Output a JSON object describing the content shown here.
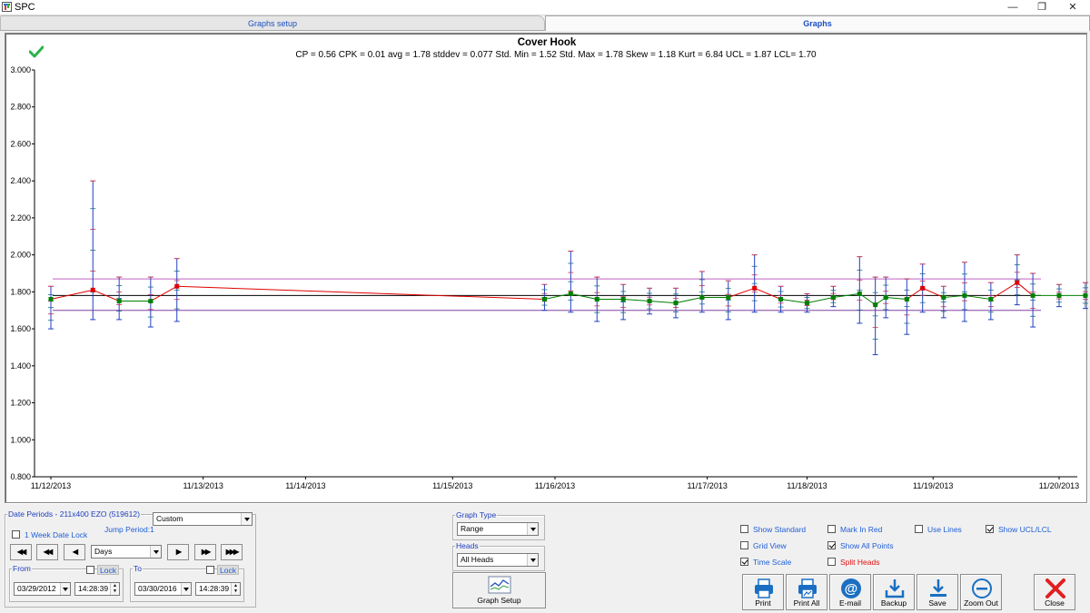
{
  "window": {
    "title": "SPC",
    "controls": [
      "—",
      "❐",
      "✕"
    ]
  },
  "tabs": [
    {
      "label": "Graphs setup",
      "active": false
    },
    {
      "label": "Graphs",
      "active": true
    }
  ],
  "chart": {
    "title": "Cover Hook",
    "stats": "CP = 0.56   CPK = 0.01   avg = 1.78   stddev = 0.077   Std. Min = 1.52   Std. Max = 1.78   Skew = 1.18   Kurt = 6.84   UCL = 1.87   LCL= 1.70",
    "status_icon": "check-icon"
  },
  "chart_data": {
    "type": "line",
    "x_axis": {
      "kind": "date",
      "range": [
        "2013-11-12",
        "2013-11-20"
      ],
      "tick_labels": [
        "11/12/2013",
        "11/13/2013",
        "11/14/2013",
        "11/15/2013",
        "11/16/2013",
        "11/17/2013",
        "11/18/2013",
        "11/19/2013",
        "11/20/2013"
      ],
      "tick_dates": [
        "2013-11-12 00:00",
        "2013-11-13 05:00",
        "2013-11-14 00:30",
        "2013-11-15 04:30",
        "2013-11-16 00:00",
        "2013-11-17 05:00",
        "2013-11-18 00:00",
        "2013-11-19 00:00",
        "2013-11-20 00:00"
      ]
    },
    "ylim": [
      0.8,
      3.0
    ],
    "y_tick_labels": [
      "0.800",
      "1.000",
      "1.200",
      "1.400",
      "1.600",
      "1.800",
      "2.000",
      "2.200",
      "2.400",
      "2.600",
      "2.800",
      "3.000"
    ],
    "control_lines": {
      "ucl": 1.87,
      "avg": 1.78,
      "lcl": 1.7
    },
    "colors": {
      "ucl": "#c060c0",
      "avg": "#000000",
      "lcl": "#8040a0",
      "series": "#008000",
      "series_alt": "#e00000",
      "range": "#2040c0",
      "range_cap": "#c03050",
      "tick": "#1a6b8a"
    },
    "points": [
      {
        "t": "2013-11-12 00:00",
        "v": 1.76,
        "min": 1.6,
        "max": 1.83
      },
      {
        "t": "2013-11-12 08:00",
        "v": 1.81,
        "min": 1.65,
        "max": 2.4
      },
      {
        "t": "2013-11-12 13:00",
        "v": 1.75,
        "min": 1.65,
        "max": 1.88
      },
      {
        "t": "2013-11-12 19:00",
        "v": 1.75,
        "min": 1.61,
        "max": 1.88
      },
      {
        "t": "2013-11-13 00:00",
        "v": 1.83,
        "min": 1.64,
        "max": 1.98
      },
      {
        "t": "2013-11-15 22:00",
        "v": 1.76,
        "min": 1.7,
        "max": 1.84
      },
      {
        "t": "2013-11-16 03:00",
        "v": 1.79,
        "min": 1.69,
        "max": 2.02
      },
      {
        "t": "2013-11-16 08:00",
        "v": 1.76,
        "min": 1.64,
        "max": 1.88
      },
      {
        "t": "2013-11-16 13:00",
        "v": 1.76,
        "min": 1.65,
        "max": 1.84
      },
      {
        "t": "2013-11-16 18:00",
        "v": 1.75,
        "min": 1.68,
        "max": 1.82
      },
      {
        "t": "2013-11-16 23:00",
        "v": 1.74,
        "min": 1.66,
        "max": 1.82
      },
      {
        "t": "2013-11-17 04:00",
        "v": 1.77,
        "min": 1.69,
        "max": 1.91
      },
      {
        "t": "2013-11-17 09:00",
        "v": 1.77,
        "min": 1.65,
        "max": 1.86
      },
      {
        "t": "2013-11-17 14:00",
        "v": 1.82,
        "min": 1.69,
        "max": 2.0
      },
      {
        "t": "2013-11-17 19:00",
        "v": 1.76,
        "min": 1.69,
        "max": 1.83
      },
      {
        "t": "2013-11-18 00:00",
        "v": 1.74,
        "min": 1.69,
        "max": 1.79
      },
      {
        "t": "2013-11-18 05:00",
        "v": 1.77,
        "min": 1.72,
        "max": 1.83
      },
      {
        "t": "2013-11-18 10:00",
        "v": 1.79,
        "min": 1.63,
        "max": 1.99
      },
      {
        "t": "2013-11-18 13:00",
        "v": 1.73,
        "min": 1.46,
        "max": 1.88
      },
      {
        "t": "2013-11-18 15:00",
        "v": 1.77,
        "min": 1.66,
        "max": 1.88
      },
      {
        "t": "2013-11-18 19:00",
        "v": 1.76,
        "min": 1.57,
        "max": 1.87
      },
      {
        "t": "2013-11-18 22:00",
        "v": 1.82,
        "min": 1.69,
        "max": 1.95
      },
      {
        "t": "2013-11-19 02:00",
        "v": 1.77,
        "min": 1.66,
        "max": 1.83
      },
      {
        "t": "2013-11-19 06:00",
        "v": 1.78,
        "min": 1.64,
        "max": 1.96
      },
      {
        "t": "2013-11-19 11:00",
        "v": 1.76,
        "min": 1.65,
        "max": 1.85
      },
      {
        "t": "2013-11-19 16:00",
        "v": 1.85,
        "min": 1.73,
        "max": 2.0
      },
      {
        "t": "2013-11-19 19:00",
        "v": 1.78,
        "min": 1.61,
        "max": 1.9
      },
      {
        "t": "2013-11-20 00:00",
        "v": 1.78,
        "min": 1.72,
        "max": 1.84
      },
      {
        "t": "2013-11-20 05:00",
        "v": 1.78,
        "min": 1.71,
        "max": 1.85
      }
    ]
  },
  "date_periods": {
    "label": "Date Periods - 211x400 EZO (519612)",
    "period_select": "Custom",
    "week_lock_label": "1 Week Date Lock",
    "week_lock_checked": false,
    "jump_period": "Jump Period:1",
    "unit_select": "Days",
    "nav_buttons": [
      "◀◀",
      "◀◀",
      "◀",
      "▶",
      "▶▶",
      "▶▶▶"
    ],
    "from": {
      "label": "From",
      "lock_label": "Lock",
      "date": "03/29/2012",
      "time": "14:28:39"
    },
    "to": {
      "label": "To",
      "lock_label": "Lock",
      "date": "03/30/2016",
      "time": "14:28:39"
    }
  },
  "graph_type": {
    "label": "Graph Type",
    "value": "Range"
  },
  "heads": {
    "label": "Heads",
    "value": "All Heads"
  },
  "graph_setup_button": {
    "label": "Graph Setup"
  },
  "options": [
    {
      "label": "Show Standard",
      "checked": false,
      "color": "blue"
    },
    {
      "label": "Mark In Red",
      "checked": false,
      "color": "blue"
    },
    {
      "label": "Use Lines",
      "checked": false,
      "color": "blue"
    },
    {
      "label": "Show UCL/LCL",
      "checked": true,
      "color": "blue"
    },
    {
      "label": "Grid View",
      "checked": false,
      "color": "blue"
    },
    {
      "label": "Show All Points",
      "checked": true,
      "color": "blue"
    },
    {
      "label": "Time Scale",
      "checked": true,
      "color": "blue"
    },
    {
      "label": "Split Heads",
      "checked": false,
      "color": "red"
    }
  ],
  "actions": [
    {
      "label": "Print",
      "icon": "printer-icon"
    },
    {
      "label": "Print All",
      "icon": "printer-all-icon"
    },
    {
      "label": "E-mail",
      "icon": "email-icon"
    },
    {
      "label": "Backup",
      "icon": "backup-icon"
    },
    {
      "label": "Save",
      "icon": "save-icon"
    },
    {
      "label": "Zoom Out",
      "icon": "zoom-out-icon"
    },
    {
      "label": "Close",
      "icon": "close-icon"
    }
  ]
}
